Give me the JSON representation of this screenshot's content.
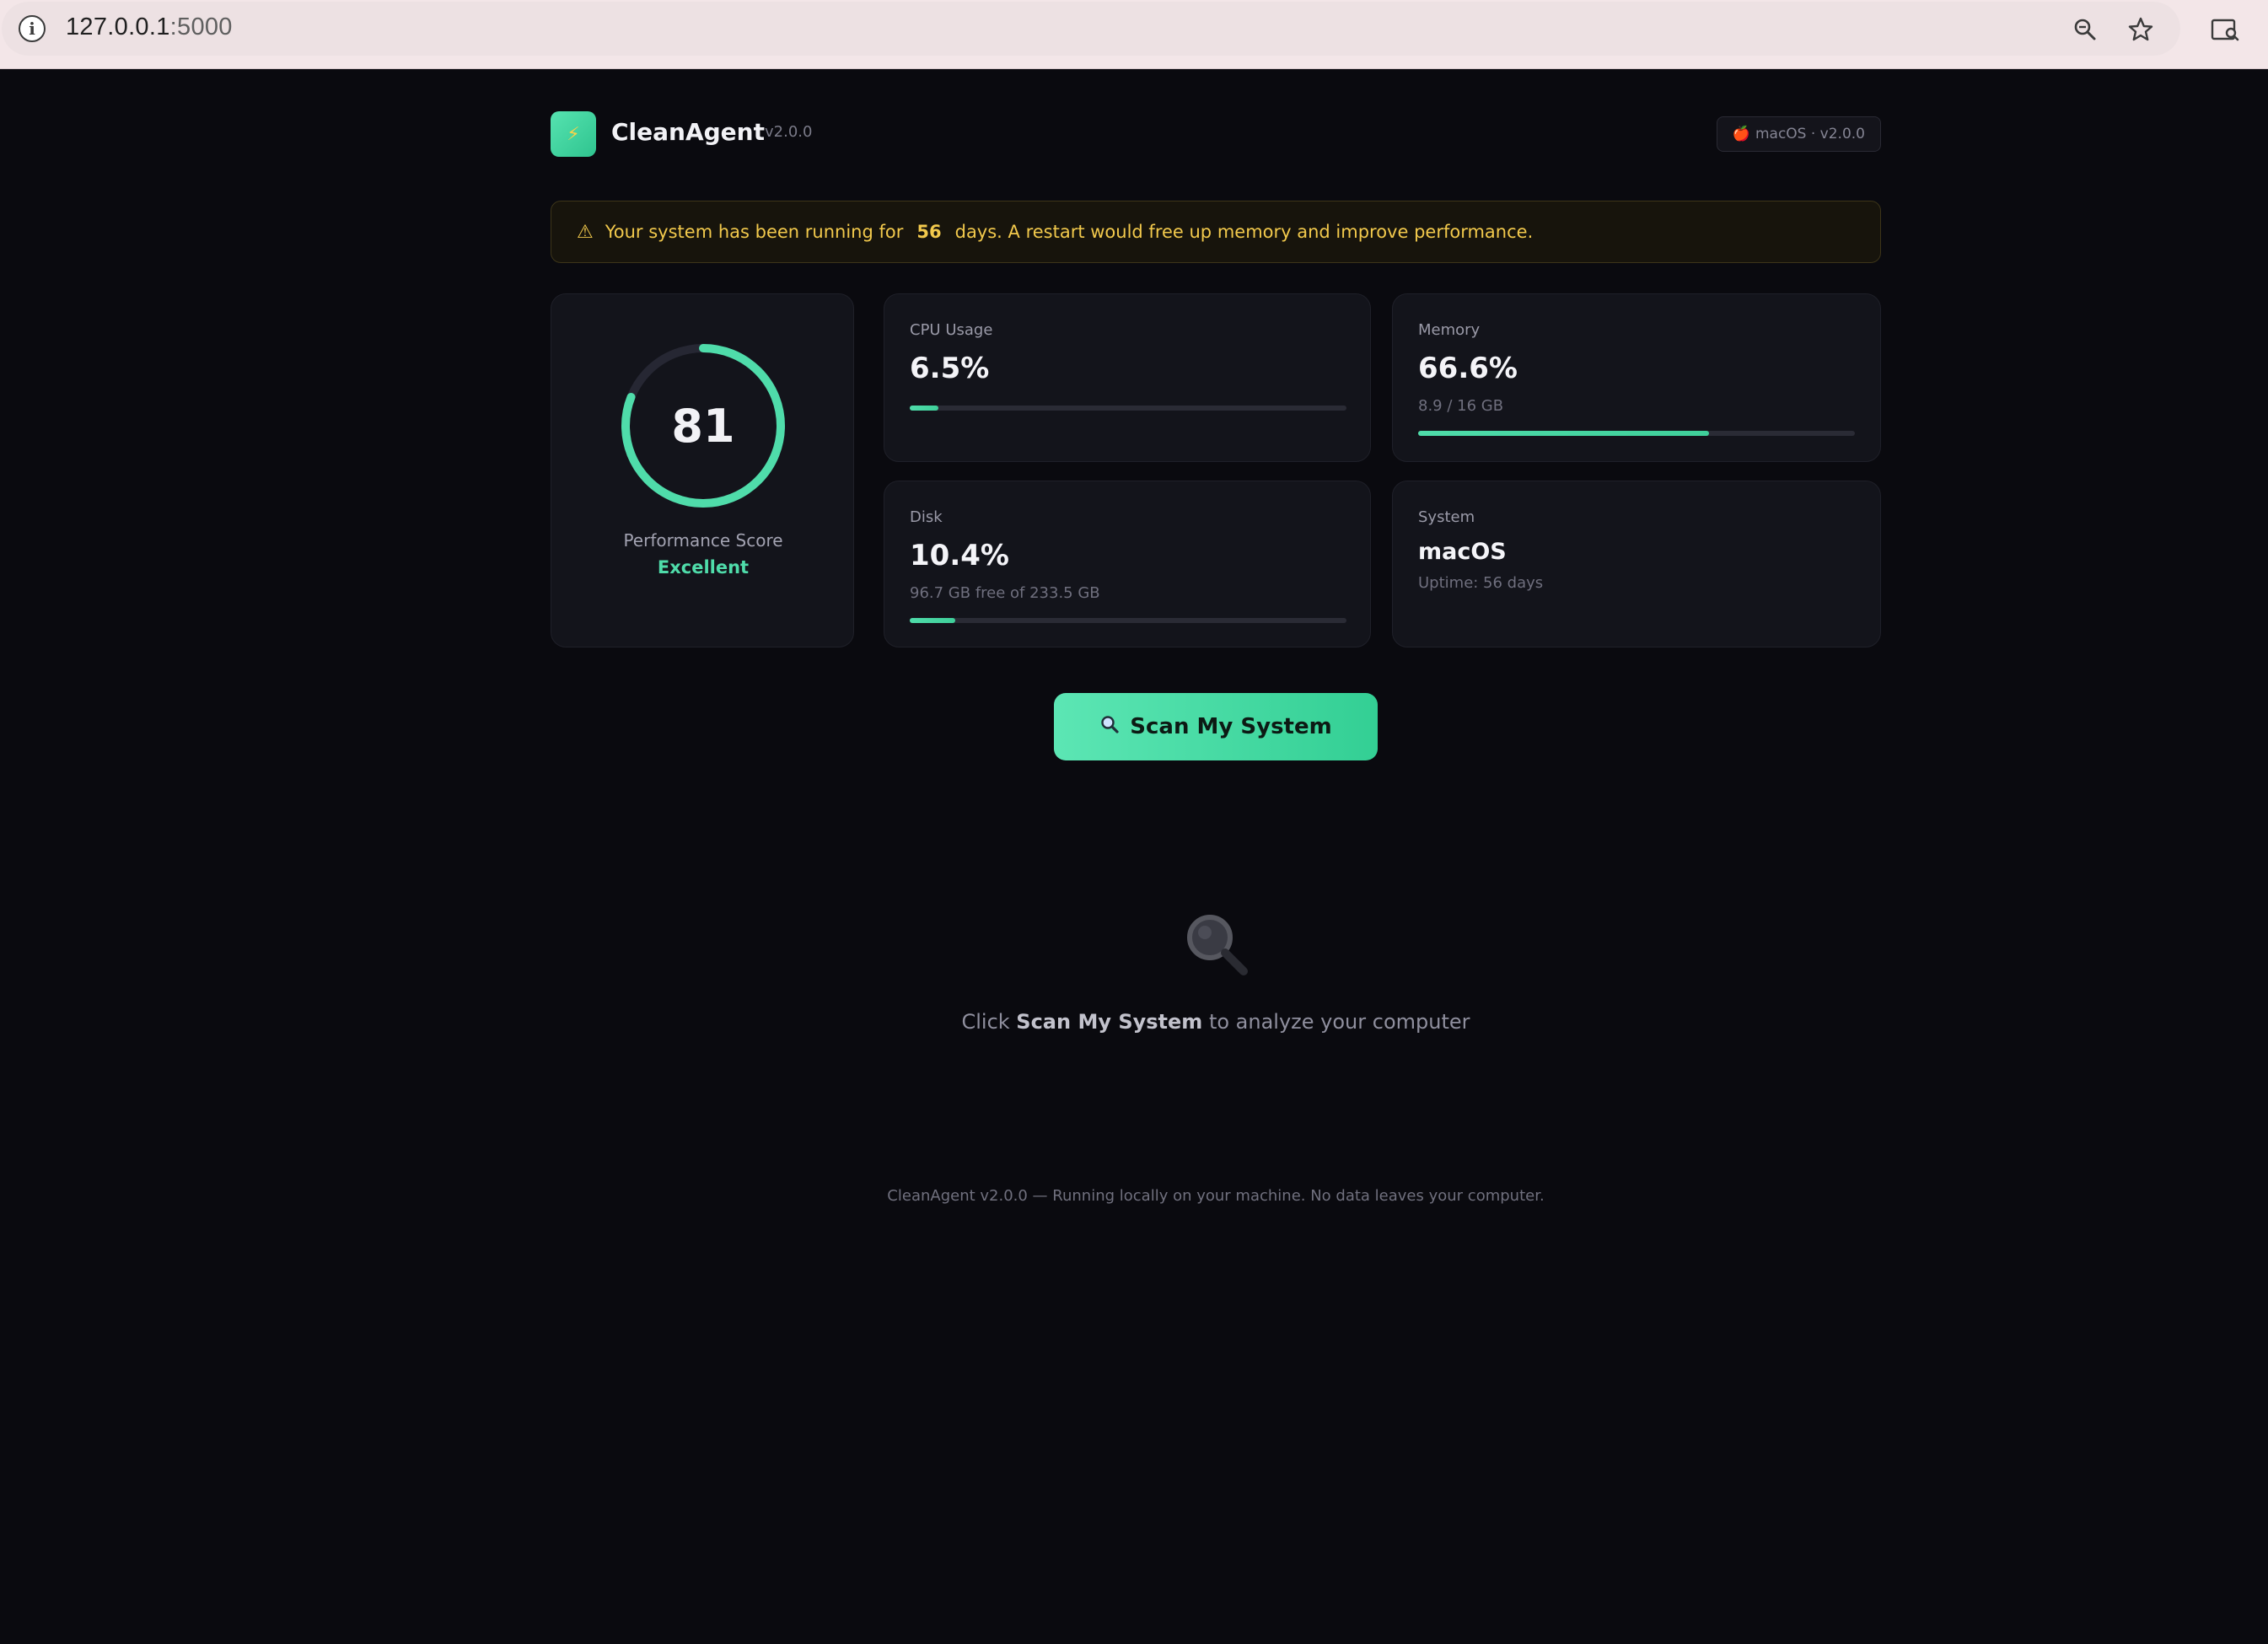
{
  "browser": {
    "url_host": "127.0.0.1",
    "url_port": ":5000"
  },
  "header": {
    "app_name": "CleanAgent",
    "version": "v2.0.0",
    "os_badge": "macOS · v2.0.0"
  },
  "alert": {
    "prefix": "Your system has been running for",
    "days": "56",
    "suffix": "days. A restart would free up memory and improve performance."
  },
  "score": {
    "value": "81",
    "fraction": 0.81,
    "label": "Performance Score",
    "rating": "Excellent"
  },
  "cpu": {
    "label": "CPU Usage",
    "value": "6.5%",
    "fraction": 0.065
  },
  "memory": {
    "label": "Memory",
    "value": "66.6%",
    "sub": "8.9 / 16 GB",
    "fraction": 0.666
  },
  "disk": {
    "label": "Disk",
    "value": "10.4%",
    "sub": "96.7 GB free of 233.5 GB",
    "fraction": 0.104
  },
  "system": {
    "label": "System",
    "os": "macOS",
    "uptime": "Uptime: 56 days"
  },
  "scan_button": {
    "label": "Scan My System"
  },
  "hint": {
    "prefix": "Click",
    "emphasis": "Scan My System",
    "suffix": "to analyze your computer"
  },
  "footer": {
    "text": "CleanAgent v2.0.0 — Running locally on your machine. No data leaves your computer."
  },
  "colors": {
    "accent": "#4fdcaa",
    "warning": "#f2c94c",
    "background": "#0a0a0f"
  }
}
